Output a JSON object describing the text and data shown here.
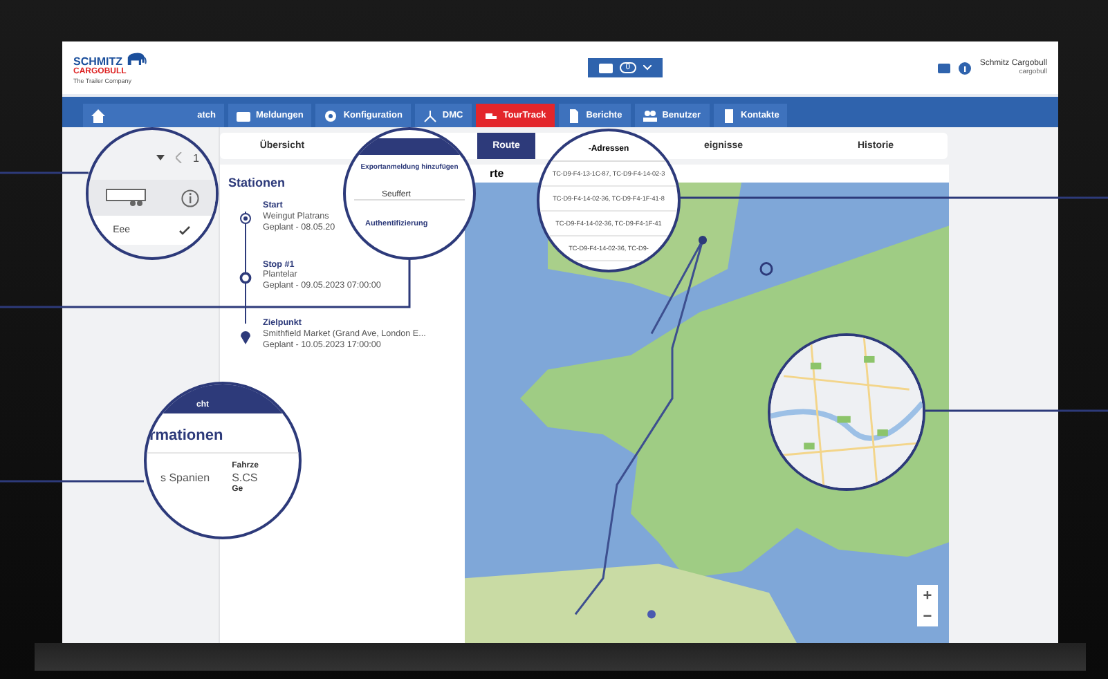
{
  "header": {
    "logo": {
      "line1": "SCHMITZ",
      "line2": "CARGOBULL",
      "tagline": "The Trailer Company"
    },
    "message_count": "0",
    "user": {
      "name": "Schmitz Cargobull",
      "account": "cargobull"
    }
  },
  "nav": [
    {
      "label": "atch",
      "selected": false
    },
    {
      "label": "Meldungen",
      "selected": false
    },
    {
      "label": "Konfiguration",
      "selected": false
    },
    {
      "label": "DMC",
      "selected": false
    },
    {
      "label": "TourTrack",
      "selected": true
    },
    {
      "label": "Berichte",
      "selected": false
    },
    {
      "label": "Benutzer",
      "selected": false
    },
    {
      "label": "Kontakte",
      "selected": false
    }
  ],
  "subtabs": [
    {
      "label": "Übersicht",
      "selected": false
    },
    {
      "label": "Route",
      "selected": true
    },
    {
      "label": "eignisse",
      "selected": false
    },
    {
      "label": "Historie",
      "selected": false
    }
  ],
  "stations": {
    "title": "Stationen",
    "items": [
      {
        "kind": "start",
        "name": "Start",
        "place": "Weingut Platrans",
        "planned": "Geplant - 08.05.20"
      },
      {
        "kind": "stop",
        "name": "Stop #1",
        "place": "Plantelar",
        "planned": "Geplant - 09.05.2023 07:00:00"
      },
      {
        "kind": "end",
        "name": "Zielpunkt",
        "place": "Smithfield Market (Grand Ave, London E...",
        "planned": "Geplant - 10.05.2023 17:00:00"
      }
    ]
  },
  "map": {
    "header": "rte",
    "zoom_in": "+",
    "zoom_out": "−"
  },
  "lens_panel": {
    "pager": "1",
    "vehicle": "Eee"
  },
  "lens_export": {
    "title": "Exportanmeldung hinzufügen",
    "field": "Seuffert",
    "section": "Authentifizierung"
  },
  "lens_addresses": {
    "header": "-Adressen",
    "rows": [
      "TC-D9-F4-13-1C-87, TC-D9-F4-14-02-3",
      "TC-D9-F4-14-02-36, TC-D9-F4-1F-41-8",
      "TC-D9-F4-14-02-36, TC-D9-F4-1F-41",
      "TC-D9-F4-14-02-36, TC-D9-"
    ]
  },
  "lens_info": {
    "tab": "cht",
    "title": "rmationen",
    "value": "s Spanien",
    "label_1": "Fahrze",
    "value_2": "S.CS",
    "label_2": "Ge"
  }
}
